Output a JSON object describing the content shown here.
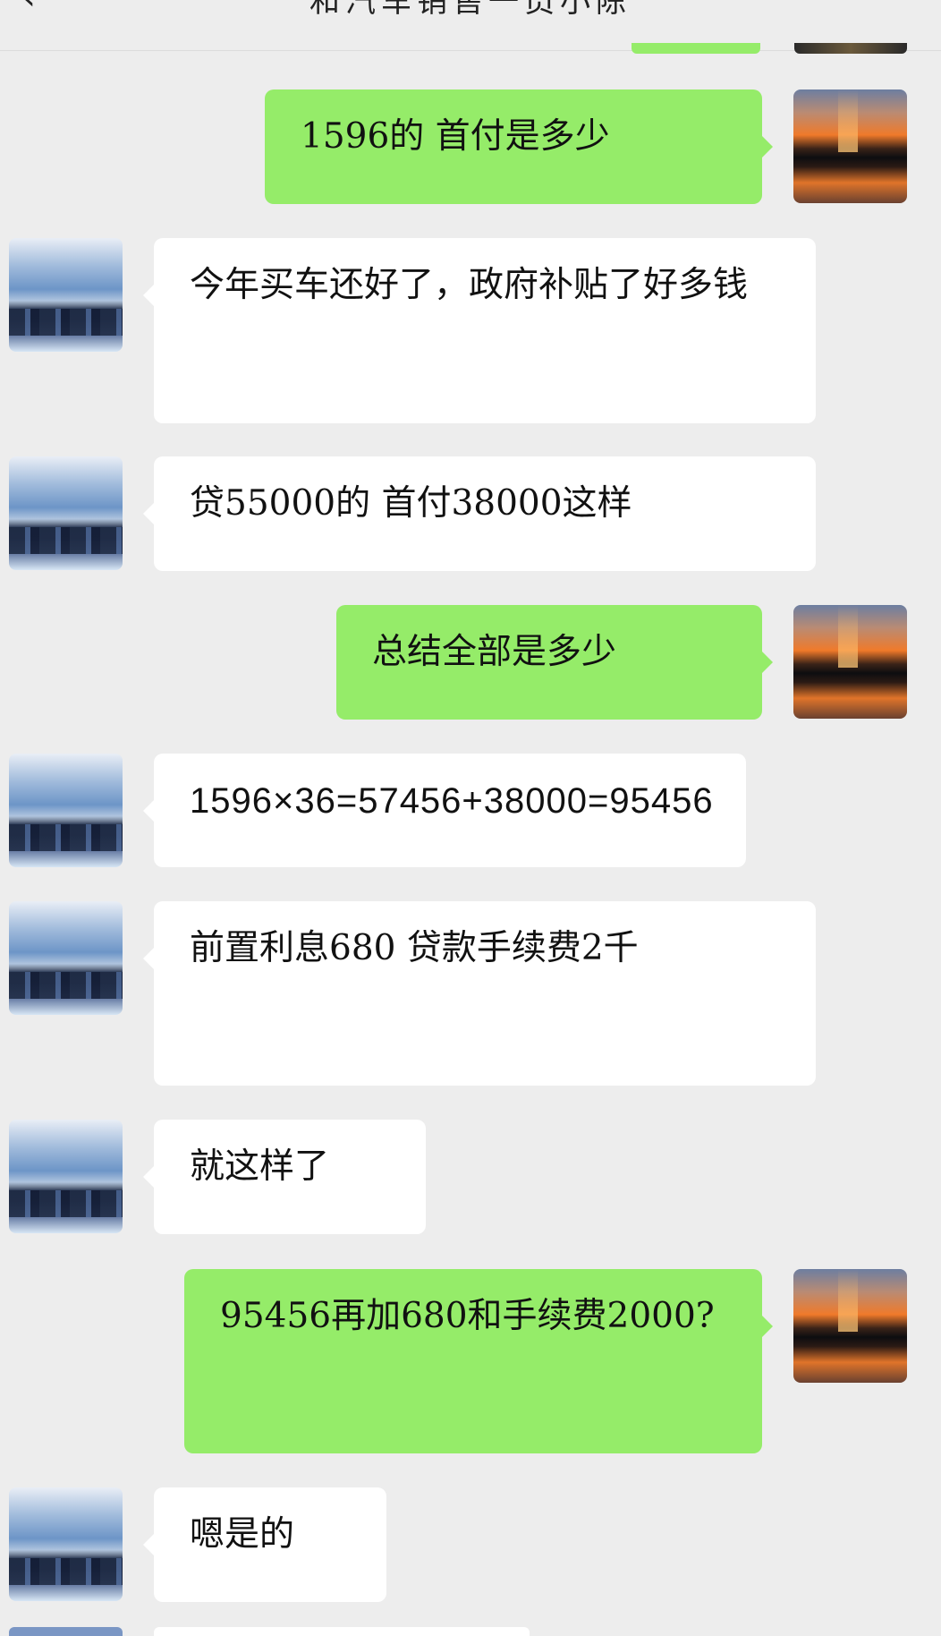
{
  "header": {
    "back_icon": "‹",
    "title": "和汽车销售一员小陈"
  },
  "messages": [
    {
      "side": "right",
      "text": "1596的 首付是多少"
    },
    {
      "side": "left",
      "text": "今年买车还好了，政府补贴了好多钱"
    },
    {
      "side": "left",
      "text": "贷55000的 首付38000这样"
    },
    {
      "side": "right",
      "text": "总结全部是多少"
    },
    {
      "side": "left",
      "text": "1596×36=57456+38000=95456"
    },
    {
      "side": "left",
      "text": "前置利息680 贷款手续费2千"
    },
    {
      "side": "left",
      "text": "就这样了"
    },
    {
      "side": "right",
      "text": "95456再加680和手续费2000?"
    },
    {
      "side": "left",
      "text": "嗯是的"
    }
  ],
  "colors": {
    "background": "#ededed",
    "sent_bubble": "#95ec69",
    "received_bubble": "#ffffff"
  }
}
